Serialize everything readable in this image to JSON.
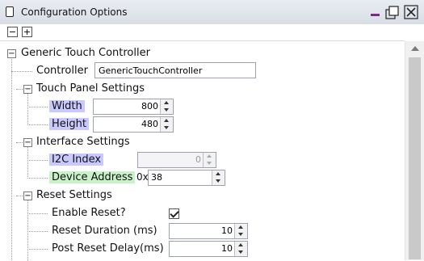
{
  "window": {
    "title": "Configuration Options"
  },
  "toolbar": {
    "collapse_label": "−",
    "expand_label": "+"
  },
  "tree": {
    "root": {
      "label": "Generic Touch Controller",
      "expander": "−"
    },
    "controller": {
      "label": "Controller",
      "value": "GenericTouchController"
    },
    "touch_panel": {
      "label": "Touch Panel Settings",
      "expander": "−",
      "width": {
        "label": "Width",
        "value": "800"
      },
      "height": {
        "label": "Height",
        "value": "480"
      }
    },
    "interface": {
      "label": "Interface Settings",
      "expander": "−",
      "i2c_index": {
        "label": "I2C Index",
        "value": "0"
      },
      "device_address": {
        "label": "Device Address",
        "prefix": "0x",
        "value": "38"
      }
    },
    "reset": {
      "label": "Reset Settings",
      "expander": "−",
      "enable_reset": {
        "label": "Enable Reset?",
        "checked": true
      },
      "reset_duration": {
        "label": "Reset Duration (ms)",
        "value": "10"
      },
      "post_reset_delay": {
        "label": "Post Reset Delay(ms)",
        "value": "10"
      }
    }
  },
  "colors": {
    "highlight_blue": "#c9c9ff",
    "highlight_green": "#c9f2c9",
    "accent": "#7b2a8a"
  }
}
